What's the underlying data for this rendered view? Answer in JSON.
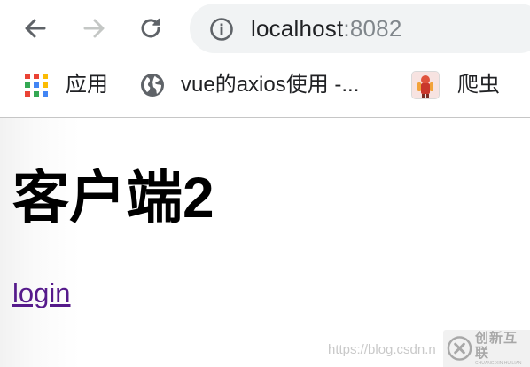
{
  "toolbar": {
    "address": {
      "host": "localhost",
      "port": ":8082"
    },
    "icons": {
      "back": "arrow-left-icon",
      "forward": "arrow-right-icon",
      "reload": "reload-icon",
      "site_info": "info-icon"
    }
  },
  "bookmarks": {
    "items": [
      {
        "label": "应用",
        "icon": "apps-grid-icon"
      },
      {
        "label": "vue的axios使用 -...",
        "icon": "globe-icon"
      },
      {
        "label": "爬虫",
        "icon": "spider-favicon-icon"
      }
    ]
  },
  "page": {
    "heading": "客户端2",
    "link_label": "login"
  },
  "watermark": {
    "url_text": "https://blog.csdn.n",
    "brand_name": "创新互联",
    "brand_sub": "CHUANG XIN HU LIAN"
  },
  "colors": {
    "link": "#551a8b",
    "omnibox_bg": "#f1f3f4",
    "text": "#202124",
    "port_text": "#80868b",
    "forward_disabled": "#c4c7c5"
  }
}
